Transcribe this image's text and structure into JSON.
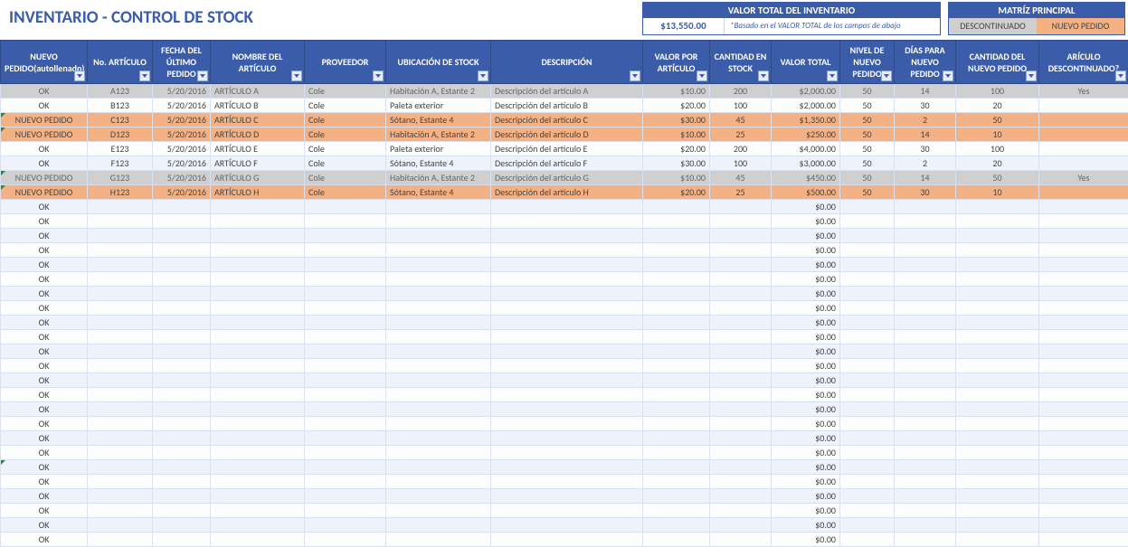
{
  "title": "INVENTARIO - CONTROL DE STOCK",
  "total": {
    "header": "VALOR TOTAL DEL INVENTARIO",
    "value": "$13,550.00",
    "note": "*Basado en el VALOR TOTAL de los campos de abajo"
  },
  "legend": {
    "header": "MATRÍZ PRINCIPAL",
    "discontinued": "DESCONTINUADO",
    "reorder": "NUEVO PEDIDO"
  },
  "columns": [
    "NUEVO PEDIDO(autollenado)",
    "No. ARTÍCULO",
    "FECHA DEL ÚLTIMO PEDIDO",
    "NOMBRE DEL ARTÍCULO",
    "PROVEEDOR",
    "UBICACIÓN DE STOCK",
    "DESCRIPCIÓN",
    "VALOR POR ARTÍCULO",
    "CANTIDAD EN STOCK",
    "VALOR TOTAL",
    "NIVEL DE NUEVO PEDIDO",
    "DÍAS PARA NUEVO PEDIDO",
    "CANTIDAD DEL NUEVO PEDIDO",
    "ARÍCULO DESCONTINUADO?"
  ],
  "rows": [
    {
      "style": "disc",
      "status": "OK",
      "num": "A123",
      "date": "5/20/2016",
      "name": "ARTÍCULO A",
      "vendor": "Cole",
      "loc": "Habitación A, Estante 2",
      "desc": "Descripción del artículo A",
      "cost": "$10.00",
      "qty": "200",
      "total": "$2,000.00",
      "rlvl": "50",
      "days": "14",
      "rqty": "100",
      "disc": "Yes"
    },
    {
      "style": "b",
      "status": "OK",
      "num": "B123",
      "date": "5/20/2016",
      "name": "ARTÍCULO B",
      "vendor": "Cole",
      "loc": "Paleta exterior",
      "desc": "Descripción del artículo B",
      "cost": "$20.00",
      "qty": "100",
      "total": "$2,000.00",
      "rlvl": "50",
      "days": "30",
      "rqty": "20",
      "disc": ""
    },
    {
      "style": "new",
      "flag": true,
      "status": "NUEVO PEDIDO",
      "num": "C123",
      "date": "5/20/2016",
      "name": "ARTÍCULO C",
      "vendor": "Cole",
      "loc": "Sótano, Estante 4",
      "desc": "Descripción del artículo C",
      "cost": "$30.00",
      "qty": "45",
      "total": "$1,350.00",
      "rlvl": "50",
      "days": "2",
      "rqty": "50",
      "disc": ""
    },
    {
      "style": "new",
      "flag": true,
      "status": "NUEVO PEDIDO",
      "num": "D123",
      "date": "5/20/2016",
      "name": "ARTÍCULO D",
      "vendor": "Cole",
      "loc": "Habitación A, Estante 2",
      "desc": "Descripción del artículo D",
      "cost": "$10.00",
      "qty": "25",
      "total": "$250.00",
      "rlvl": "50",
      "days": "14",
      "rqty": "10",
      "disc": ""
    },
    {
      "style": "b",
      "status": "OK",
      "num": "E123",
      "date": "5/20/2016",
      "name": "ARTÍCULO E",
      "vendor": "Cole",
      "loc": "Paleta exterior",
      "desc": "Descripción del artículo E",
      "cost": "$20.00",
      "qty": "200",
      "total": "$4,000.00",
      "rlvl": "50",
      "days": "30",
      "rqty": "100",
      "disc": ""
    },
    {
      "style": "a",
      "status": "OK",
      "num": "F123",
      "date": "5/20/2016",
      "name": "ARTÍCULO F",
      "vendor": "Cole",
      "loc": "Sótano, Estante 4",
      "desc": "Descripción del artículo F",
      "cost": "$30.00",
      "qty": "100",
      "total": "$3,000.00",
      "rlvl": "50",
      "days": "2",
      "rqty": "20",
      "disc": ""
    },
    {
      "style": "disc",
      "flag": true,
      "status": "NUEVO PEDIDO",
      "num": "G123",
      "date": "5/20/2016",
      "name": "ARTÍCULO G",
      "vendor": "Cole",
      "loc": "Habitación A, Estante 2",
      "desc": "Descripción del artículo G",
      "cost": "$10.00",
      "qty": "45",
      "total": "$450.00",
      "rlvl": "50",
      "days": "14",
      "rqty": "50",
      "disc": "Yes"
    },
    {
      "style": "new",
      "flag": true,
      "status": "NUEVO PEDIDO",
      "num": "H123",
      "date": "5/20/2016",
      "name": "ARTÍCULO H",
      "vendor": "Cole",
      "loc": "Sótano, Estante 4",
      "desc": "Descripción del artículo H",
      "cost": "$20.00",
      "qty": "25",
      "total": "$500.00",
      "rlvl": "50",
      "days": "30",
      "rqty": "10",
      "disc": ""
    }
  ],
  "empty": {
    "status": "OK",
    "total": "$0.00",
    "count": 24
  }
}
